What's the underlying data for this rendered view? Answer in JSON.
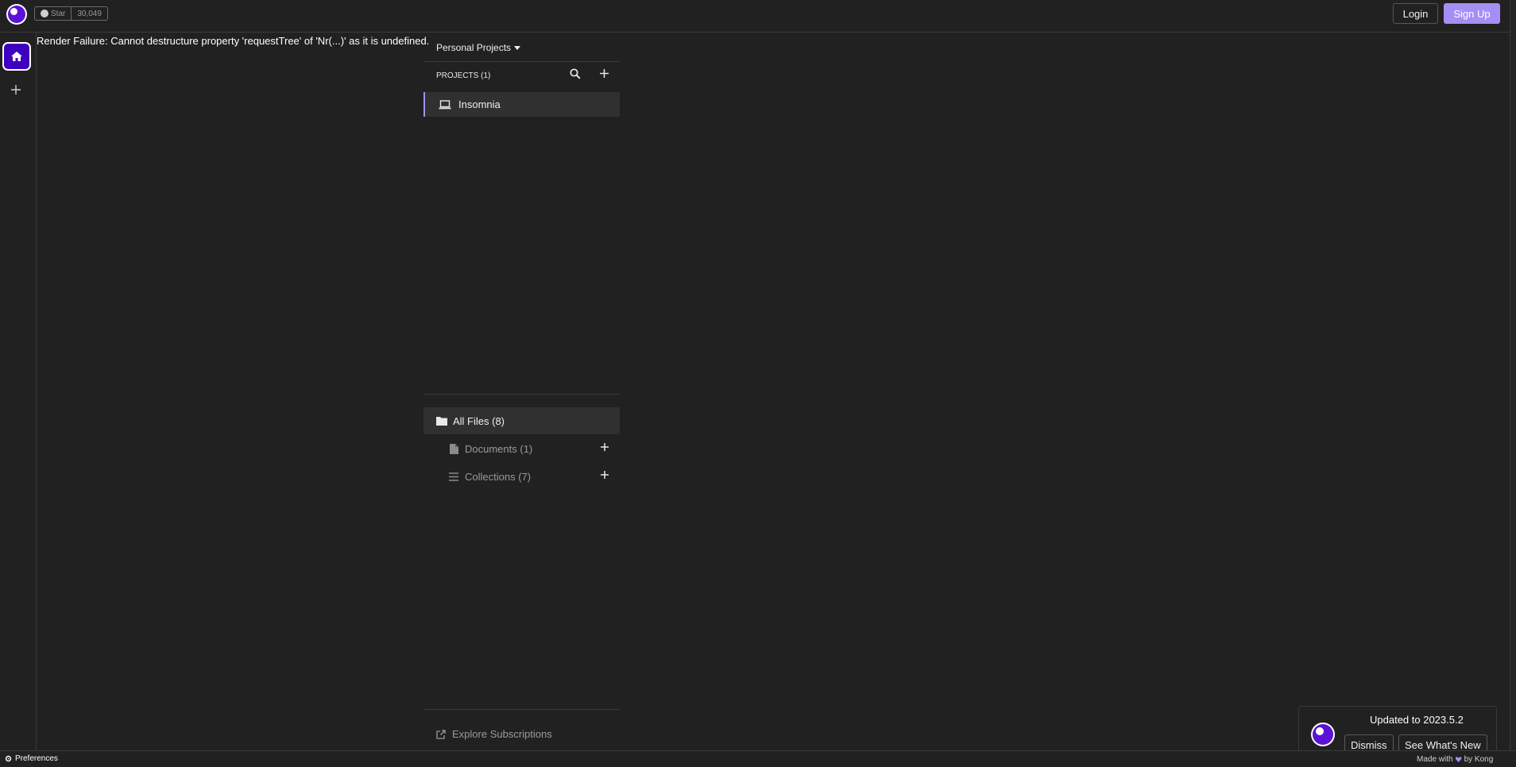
{
  "header": {
    "github": {
      "star_label": "Star",
      "star_count": "30,049"
    },
    "login_label": "Login",
    "signup_label": "Sign Up"
  },
  "main": {
    "error_message": "Render Failure: Cannot destructure property 'requestTree' of 'Nr(...)' as it is undefined."
  },
  "projects_panel": {
    "organization": "Personal Projects",
    "projects_header": "PROJECTS (1)",
    "projects": [
      {
        "name": "Insomnia",
        "icon": "laptop-icon",
        "active": true
      }
    ],
    "files": {
      "all_label": "All Files (8)",
      "documents_label": "Documents (1)",
      "collections_label": "Collections (7)"
    },
    "explore_label": "Explore Subscriptions"
  },
  "statusbar": {
    "preferences_label": "Preferences",
    "made_with_prefix": "Made with",
    "made_with_suffix": "by Kong"
  },
  "toast": {
    "message": "Updated to 2023.5.2",
    "dismiss_label": "Dismiss",
    "whats_new_label": "See What's New"
  },
  "colors": {
    "background": "#212121",
    "accent": "#a58ff5",
    "brand": "#4000bf",
    "border": "#3a3a3a"
  }
}
